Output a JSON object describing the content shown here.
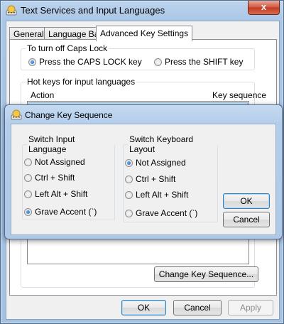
{
  "window": {
    "title": "Text Services and Input Languages",
    "close_glyph": "x"
  },
  "tabs": [
    "General",
    "Language Bar",
    "Advanced Key Settings"
  ],
  "caps_lock": {
    "legend": "To turn off Caps Lock",
    "options": [
      "Press the CAPS LOCK key",
      "Press the SHIFT key"
    ],
    "selected": 0
  },
  "hotkeys": {
    "legend": "Hot keys for input languages",
    "col_action": "Action",
    "col_sequence": "Key sequence",
    "change_button": "Change Key Sequence..."
  },
  "footer": {
    "ok": "OK",
    "cancel": "Cancel",
    "apply": "Apply"
  },
  "dialog": {
    "title": "Change Key Sequence",
    "switch_language": {
      "legend": "Switch Input Language",
      "options": [
        "Not Assigned",
        "Ctrl + Shift",
        "Left Alt + Shift",
        "Grave Accent (`)"
      ],
      "selected": 3
    },
    "switch_layout": {
      "legend": "Switch Keyboard Layout",
      "options": [
        "Not Assigned",
        "Ctrl + Shift",
        "Left Alt + Shift",
        "Grave Accent (`)"
      ],
      "selected": 0
    },
    "ok": "OK",
    "cancel": "Cancel"
  },
  "colors": {
    "titlebar": "#bcd3ec",
    "close_button": "#c94a32",
    "selection": "#0c55b8"
  },
  "icons": [
    "keyboard-globe-icon",
    "close-icon",
    "radio-selected-icon"
  ]
}
